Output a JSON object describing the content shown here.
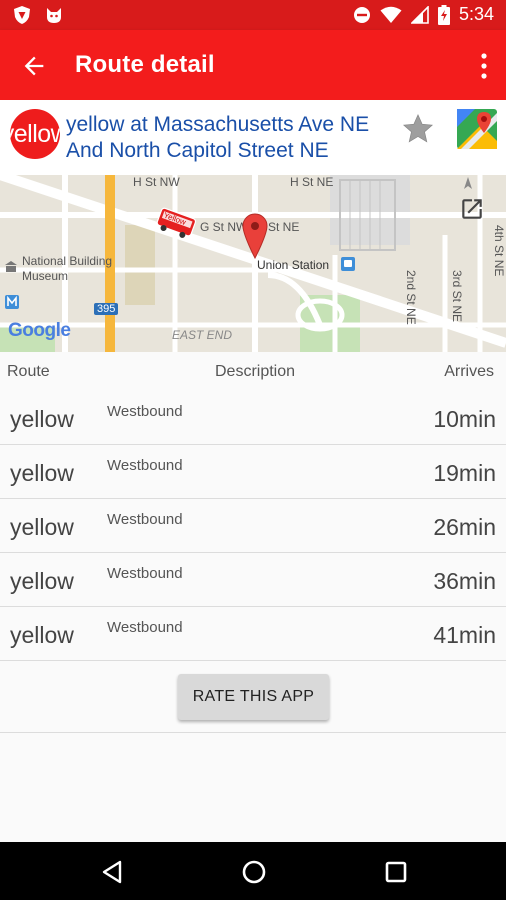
{
  "status_bar": {
    "time": "5:34"
  },
  "app_bar": {
    "title": "Route detail"
  },
  "stop": {
    "route_badge": "yellow",
    "name": "yellow at Massachusetts Ave NE And North Capitol Street NE"
  },
  "map": {
    "labels": {
      "h_st_nw_1": "H St NW",
      "h_st_ne": "H St NE",
      "g_st_nw": "G St NW",
      "st_ne": "St NE",
      "union_station": "Union Station",
      "museum_line1": "National Building",
      "museum_line2": "Museum",
      "east_end": "EAST END",
      "interstate": "395",
      "second_st_ne": "2nd St NE",
      "third_st_ne": "3rd St NE",
      "fourth_st_ne": "4th St NE",
      "google": "Google",
      "bus_label": "Yellow"
    }
  },
  "list": {
    "headers": {
      "route": "Route",
      "description": "Description",
      "arrives": "Arrives"
    },
    "rows": [
      {
        "route": "yellow",
        "description": "Westbound",
        "arrives": "10min"
      },
      {
        "route": "yellow",
        "description": "Westbound",
        "arrives": "19min"
      },
      {
        "route": "yellow",
        "description": "Westbound",
        "arrives": "26min"
      },
      {
        "route": "yellow",
        "description": "Westbound",
        "arrives": "36min"
      },
      {
        "route": "yellow",
        "description": "Westbound",
        "arrives": "41min"
      }
    ]
  },
  "rate_button": {
    "label": "RATE THIS APP"
  },
  "colors": {
    "status_bar": "#d81b1b",
    "app_bar": "#f31c1c",
    "link": "#1a4fa8"
  }
}
